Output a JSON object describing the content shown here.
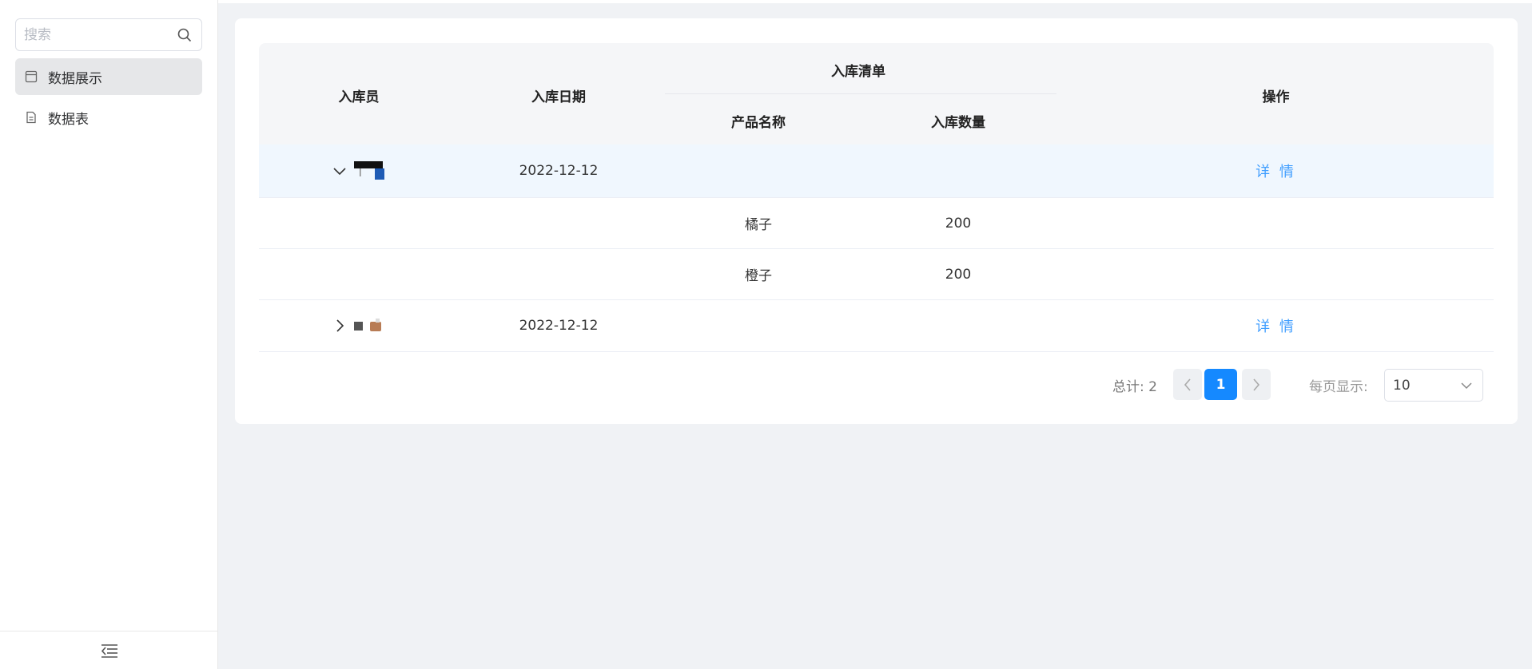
{
  "sidebar": {
    "search_placeholder": "搜索",
    "items": [
      {
        "label": "数据展示",
        "active": true
      },
      {
        "label": "数据表",
        "active": false
      }
    ]
  },
  "table": {
    "headers": {
      "operator": "入库员",
      "date": "入库日期",
      "list": "入库清单",
      "product": "产品名称",
      "quantity": "入库数量",
      "action": "操作"
    },
    "rows": [
      {
        "date": "2022-12-12",
        "action_label": "详 情",
        "expanded": true,
        "items": [
          {
            "product": "橘子",
            "quantity": "200"
          },
          {
            "product": "橙子",
            "quantity": "200"
          }
        ]
      },
      {
        "date": "2022-12-12",
        "action_label": "详 情",
        "expanded": false,
        "items": []
      }
    ]
  },
  "pagination": {
    "total_label": "总计: 2",
    "current_page": "1",
    "per_page_label": "每页显示:",
    "per_page_value": "10"
  },
  "colors": {
    "accent": "#1589ff",
    "link": "#409eff",
    "expanded_row_bg": "#f0f7fe"
  }
}
